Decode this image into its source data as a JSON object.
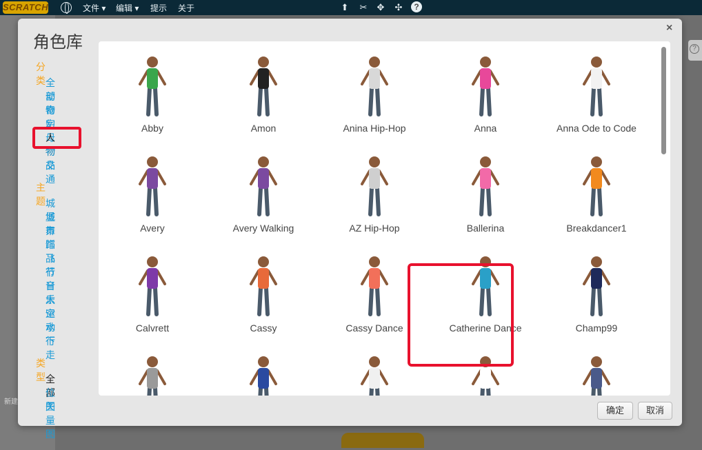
{
  "menubar": {
    "logo": "SCRATCH",
    "items": [
      {
        "label": "文件 ▾"
      },
      {
        "label": "编辑 ▾"
      },
      {
        "label": "提示"
      },
      {
        "label": "关于"
      }
    ],
    "tools": [
      "stamp-icon",
      "cut-icon",
      "grow-icon",
      "shrink-icon",
      "help-icon"
    ],
    "help_glyph": "?"
  },
  "background": {
    "side_label": "新建"
  },
  "dialog": {
    "title": "角色库",
    "close_glyph": "×",
    "filters": {
      "category_heading": "分类",
      "categories": [
        "全部",
        "动物",
        "奇幻",
        "字母",
        "人物",
        "物品",
        "交通"
      ],
      "selected_category": "人物",
      "theme_heading": "主题",
      "themes": [
        "城堡",
        "城市",
        "舞蹈",
        "饰品",
        "飞行",
        "节日",
        "音乐",
        "太空",
        "运动",
        "水下",
        "行走"
      ],
      "type_heading": "类型",
      "types": [
        "全部",
        "位图",
        "矢量图"
      ],
      "selected_type": "全部"
    },
    "sprites": [
      {
        "name": "Abby",
        "color": "#3aa64c"
      },
      {
        "name": "Amon",
        "color": "#222222"
      },
      {
        "name": "Anina Hip-Hop",
        "color": "#d8d8d8"
      },
      {
        "name": "Anna",
        "color": "#e8489a"
      },
      {
        "name": "Anna Ode to Code",
        "color": "#f2f2f2"
      },
      {
        "name": "Avery",
        "color": "#7b4aa0"
      },
      {
        "name": "Avery Walking",
        "color": "#7b4aa0"
      },
      {
        "name": "AZ Hip-Hop",
        "color": "#cfcfcf"
      },
      {
        "name": "Ballerina",
        "color": "#f26aa8"
      },
      {
        "name": "Breakdancer1",
        "color": "#f28a1e"
      },
      {
        "name": "Calvrett",
        "color": "#7e3aa8"
      },
      {
        "name": "Cassy",
        "color": "#e86a3a"
      },
      {
        "name": "Cassy Dance",
        "color": "#f2705a"
      },
      {
        "name": "Catherine Dance",
        "color": "#2aa0c8"
      },
      {
        "name": "Champ99",
        "color": "#1e2a5a"
      },
      {
        "name": "",
        "color": "#9a9a9a"
      },
      {
        "name": "",
        "color": "#2a4aa0"
      },
      {
        "name": "",
        "color": "#f0f0f0"
      },
      {
        "name": "",
        "color": "#ffffff"
      },
      {
        "name": "",
        "color": "#4a5a8a"
      }
    ],
    "selected_sprite": "Cassy Dance",
    "ok_label": "确定",
    "cancel_label": "取消"
  },
  "colors": {
    "accent_orange": "#f5a623",
    "link_blue": "#1a9ad6",
    "highlight_red": "#e8112d"
  }
}
